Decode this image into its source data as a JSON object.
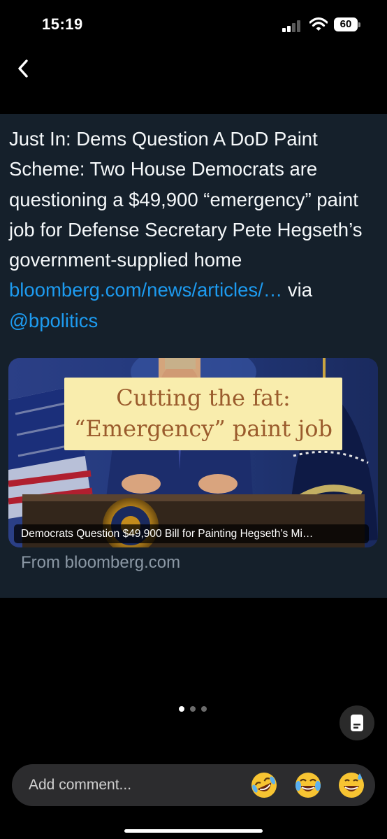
{
  "status_bar": {
    "time": "15:19",
    "battery_level": "60",
    "signal_icon": "cellular-signal-icon",
    "wifi_icon": "wifi-icon",
    "battery_icon": "battery-icon"
  },
  "nav": {
    "back_icon": "chevron-left-icon"
  },
  "post": {
    "text_prefix": "Just In: Dems Question A DoD Paint Scheme: Two House Democrats are questioning a $49,900 “emergency” paint job for Defense Secretary Pete Hegseth’s government-supplied home ",
    "link_text": "bloomberg.com/news/articles/…",
    "via_text": " via ",
    "mention": "@bpolitics",
    "link_color": "#1d9bf0",
    "card": {
      "overlay_line1": "Cutting the fat:",
      "overlay_line2": "“Emergency” paint job",
      "caption": "Democrats Question $49,900 Bill for Painting Hegseth’s Mi…",
      "source": "From bloomberg.com"
    }
  },
  "pagination": {
    "total": 3,
    "active_index": 0
  },
  "notes_icon": "document-icon",
  "comment_bar": {
    "placeholder": "Add comment...",
    "emojis": [
      {
        "name": "rolling-on-floor-laughing-emoji",
        "glyph": "🤣"
      },
      {
        "name": "tears-of-joy-emoji",
        "glyph": "😂"
      },
      {
        "name": "grinning-sweat-emoji",
        "glyph": "😅"
      }
    ]
  }
}
